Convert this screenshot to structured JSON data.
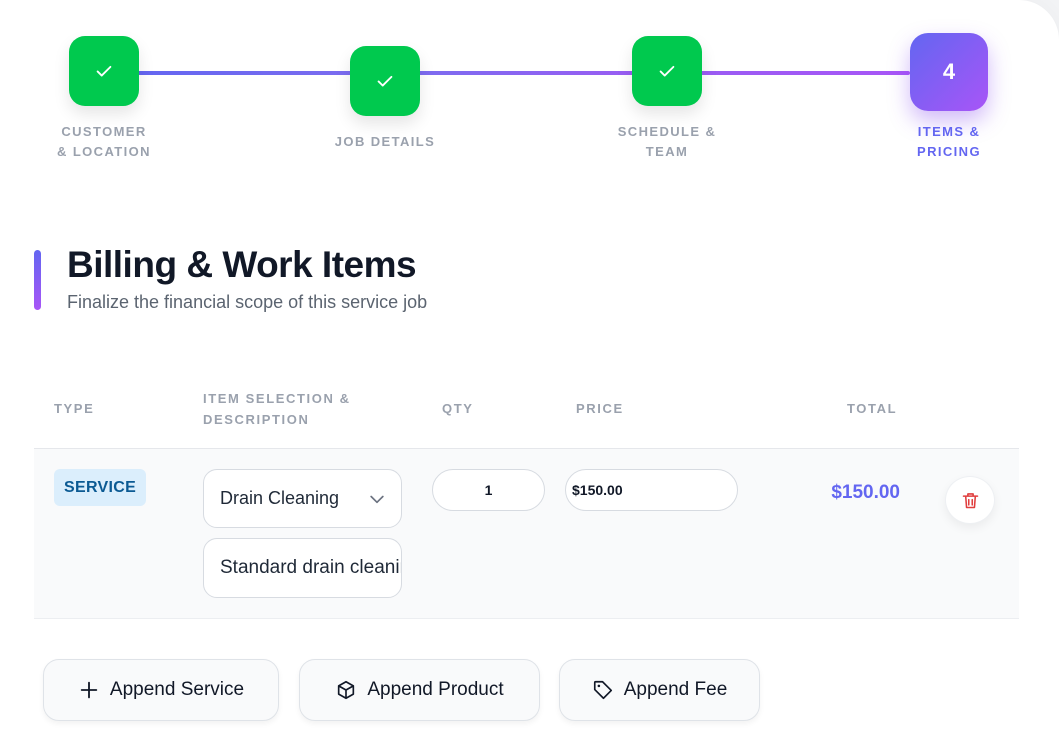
{
  "stepper": {
    "steps": [
      {
        "label_line1": "Customer",
        "label_line2": "& Location",
        "status": "done"
      },
      {
        "label_line1": "Job Details",
        "label_line2": "",
        "status": "done"
      },
      {
        "label_line1": "Schedule &",
        "label_line2": "Team",
        "status": "done"
      },
      {
        "label_line1": "Items &",
        "label_line2": "Pricing",
        "status": "active",
        "number": "4"
      }
    ],
    "done_icon": "check-icon",
    "colors": {
      "done": "#00c94e",
      "active_start": "#6366f1",
      "active_end": "#a855f7"
    }
  },
  "header": {
    "title": "Billing & Work Items",
    "subtitle": "Finalize the financial scope of this service job"
  },
  "table": {
    "columns": {
      "type": "Type",
      "item_line1": "Item Selection &",
      "item_line2": "Description",
      "qty": "Qty",
      "price": "Price",
      "total": "Total"
    },
    "rows": [
      {
        "type": "SERVICE",
        "item": "Drain Cleaning",
        "description": "Standard drain cleaning",
        "qty": "1",
        "price": "$150.00",
        "total": "$150.00",
        "delete_icon": "trash-icon"
      }
    ]
  },
  "actions": {
    "append_service": "Append Service",
    "append_product": "Append Product",
    "append_fee": "Append Fee"
  },
  "colors": {
    "accent": "#6366f1",
    "success": "#00c94e",
    "danger": "#e03e3e",
    "badge_bg": "#dbeefc",
    "badge_text": "#0b5a93"
  }
}
